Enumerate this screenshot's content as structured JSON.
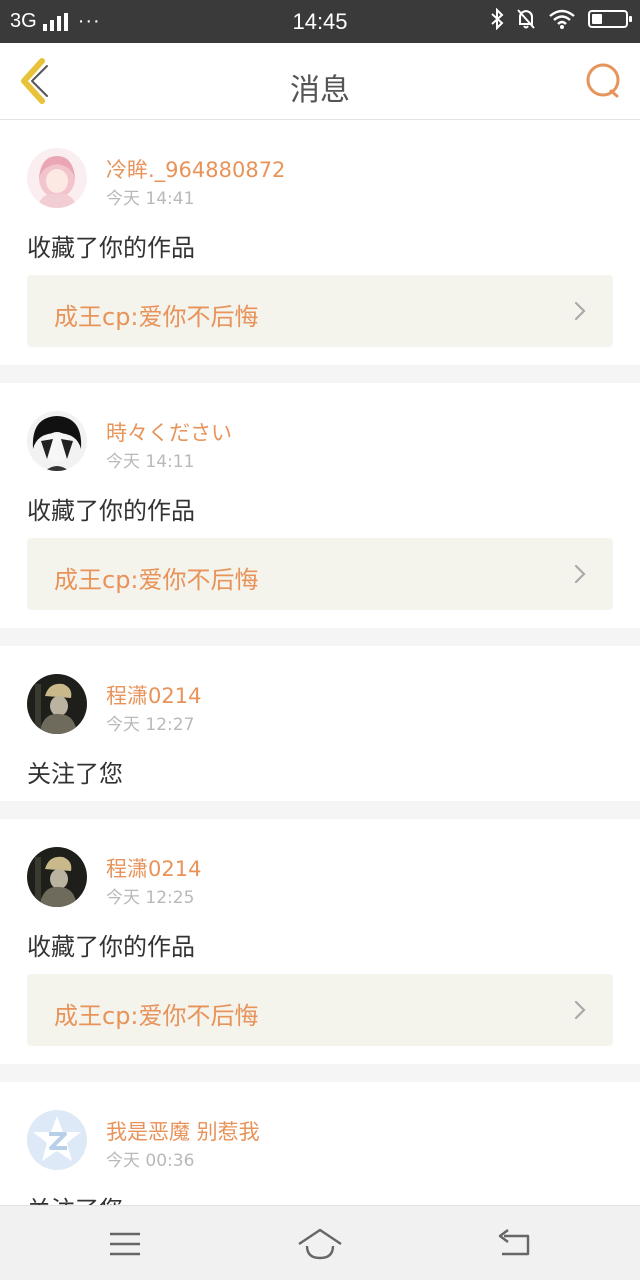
{
  "status_bar": {
    "network": "3G",
    "signal_icon": "signal-icon",
    "more_dots": "···",
    "time": "14:45",
    "bluetooth_icon": "bluetooth-icon",
    "mute_icon": "bell-off-icon",
    "wifi_icon": "wifi-icon",
    "battery_icon": "battery-icon",
    "battery_level": 0.3
  },
  "header": {
    "title": "消息",
    "back_icon": "chevron-left-icon",
    "search_icon": "search-icon",
    "accent_color": "#e8935a",
    "back_color": "#e8c33a"
  },
  "notifications": [
    {
      "username": "冷眸._964880872",
      "time": "今天 14:41",
      "action": "收藏了你的作品",
      "work_title": "成王cp:爱你不后悔"
    },
    {
      "username": "時々ください",
      "time": "今天 14:11",
      "action": "收藏了你的作品",
      "work_title": "成王cp:爱你不后悔"
    },
    {
      "username": "程潇0214",
      "time": "今天 12:27",
      "action": "关注了您"
    },
    {
      "username": "程潇0214",
      "time": "今天 12:25",
      "action": "收藏了你的作品",
      "work_title": "成王cp:爱你不后悔"
    },
    {
      "username": "我是恶魔 别惹我",
      "time": "今天 00:36",
      "action": "关注了您"
    }
  ],
  "nav_bar": {
    "menu_icon": "menu-icon",
    "home_icon": "home-icon",
    "back_icon": "return-icon"
  }
}
